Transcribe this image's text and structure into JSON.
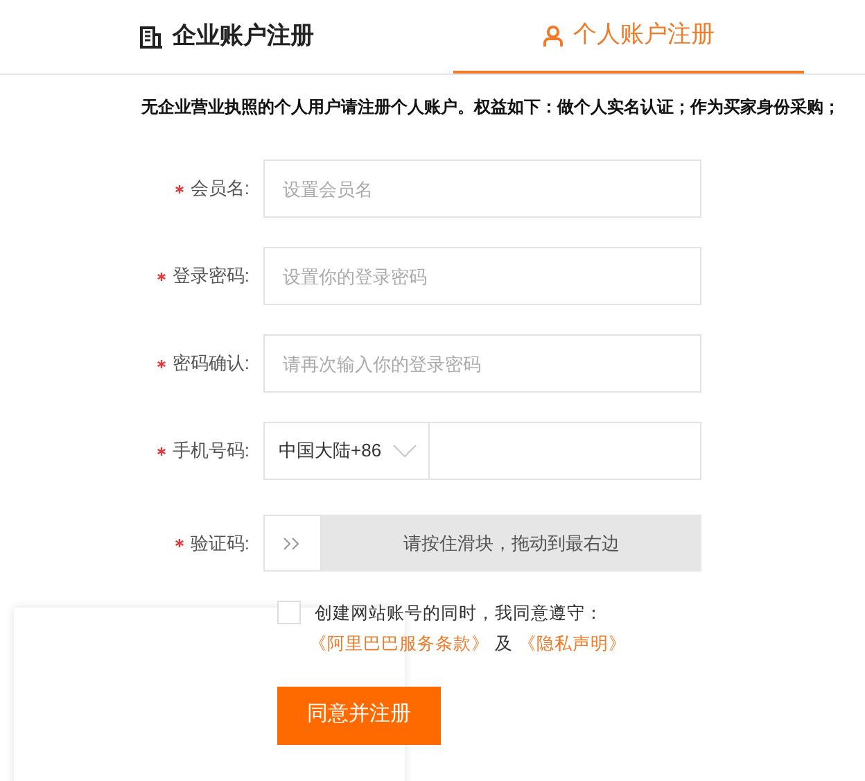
{
  "tabs": [
    {
      "label": "企业账户注册",
      "kind": "company",
      "selected": false
    },
    {
      "label": "个人账户注册",
      "kind": "person",
      "selected": true
    }
  ],
  "notice": "无企业营业执照的个人用户请注册个人账户。权益如下：做个人实名认证；作为买家身份采购；",
  "fields": [
    {
      "label": "会员名:",
      "required": true,
      "placeholder": "设置会员名"
    },
    {
      "label": "登录密码:",
      "required": true,
      "placeholder": "设置你的登录密码"
    },
    {
      "label": "密码确认:",
      "required": true,
      "placeholder": "请再次输入你的登录密码"
    }
  ],
  "phone": {
    "label": "手机号码:",
    "required": true,
    "region": "中国大陆",
    "code": "+86"
  },
  "captcha": {
    "label": "验证码:",
    "required": true,
    "hint": "请按住滑块，拖动到最右边"
  },
  "agreement": {
    "checked": false,
    "text": "创建网站账号的同时，我同意遵守：",
    "links": [
      "《阿里巴巴服务条款》",
      "《隐私声明》"
    ],
    "joiner": "及"
  },
  "submit": "同意并注册"
}
